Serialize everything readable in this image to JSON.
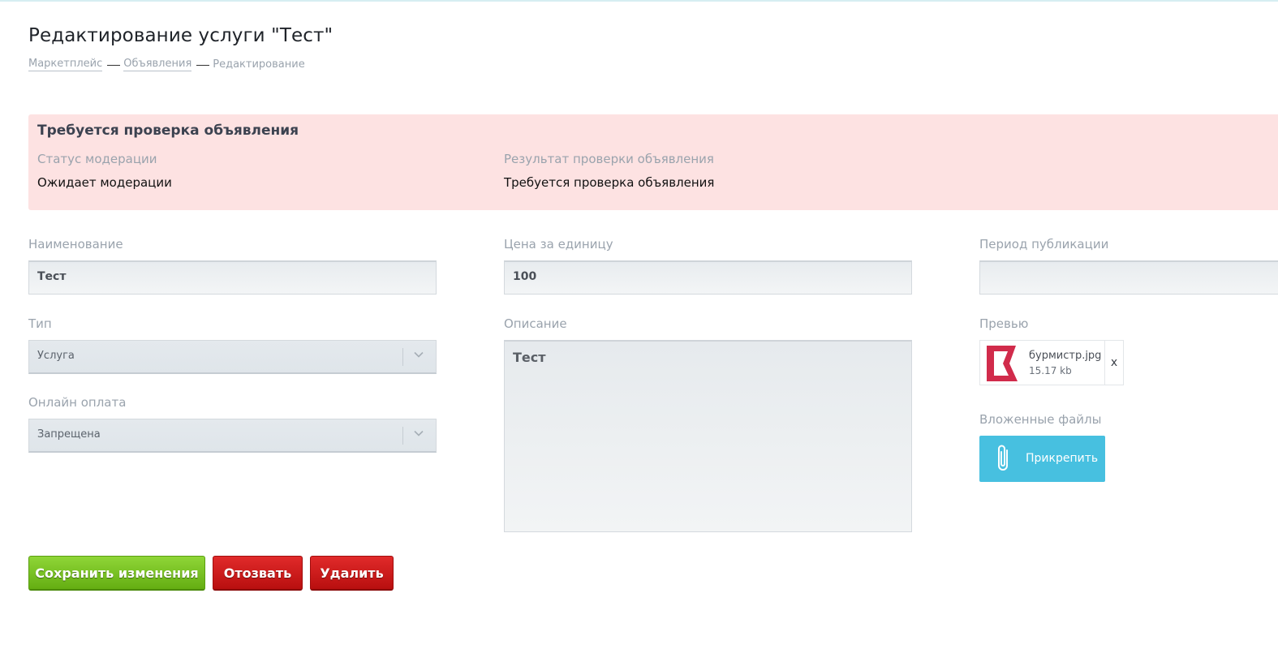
{
  "page": {
    "title": "Редактирование услуги \"Тест\"",
    "breadcrumb": [
      "Маркетплейс",
      "Объявления",
      "Редактирование"
    ]
  },
  "moderation": {
    "title": "Требуется проверка объявления",
    "status_label": "Статус модерации",
    "status_value": "Ожидает модерации",
    "result_label": "Результат проверки объявления",
    "result_value": "Требуется проверка объявления",
    "background_color": "#fde2e2"
  },
  "form": {
    "name_label": "Наименование",
    "name_value": "Тест",
    "price_label": "Цена за единицу",
    "price_value": "100",
    "period_label": "Период публикации",
    "period_value": "",
    "type_label": "Тип",
    "type_value": "Услуга",
    "description_label": "Описание",
    "description_value": "Тест",
    "online_payment_label": "Онлайн оплата",
    "online_payment_value": "Запрещена",
    "preview_label": "Превью",
    "preview_file": {
      "name": "бурмистр.jpg",
      "size": "15.17 kb",
      "remove_label": "x"
    },
    "attachments_label": "Вложенные файлы",
    "attach_button_label": "Прикрепить"
  },
  "actions": {
    "save_label": "Сохранить изменения",
    "recall_label": "Отозвать",
    "delete_label": "Удалить",
    "save_color": "#7cc527",
    "recall_color": "#cc1a1a",
    "delete_color": "#cc1a1a",
    "attach_color": "#47c0e0"
  }
}
